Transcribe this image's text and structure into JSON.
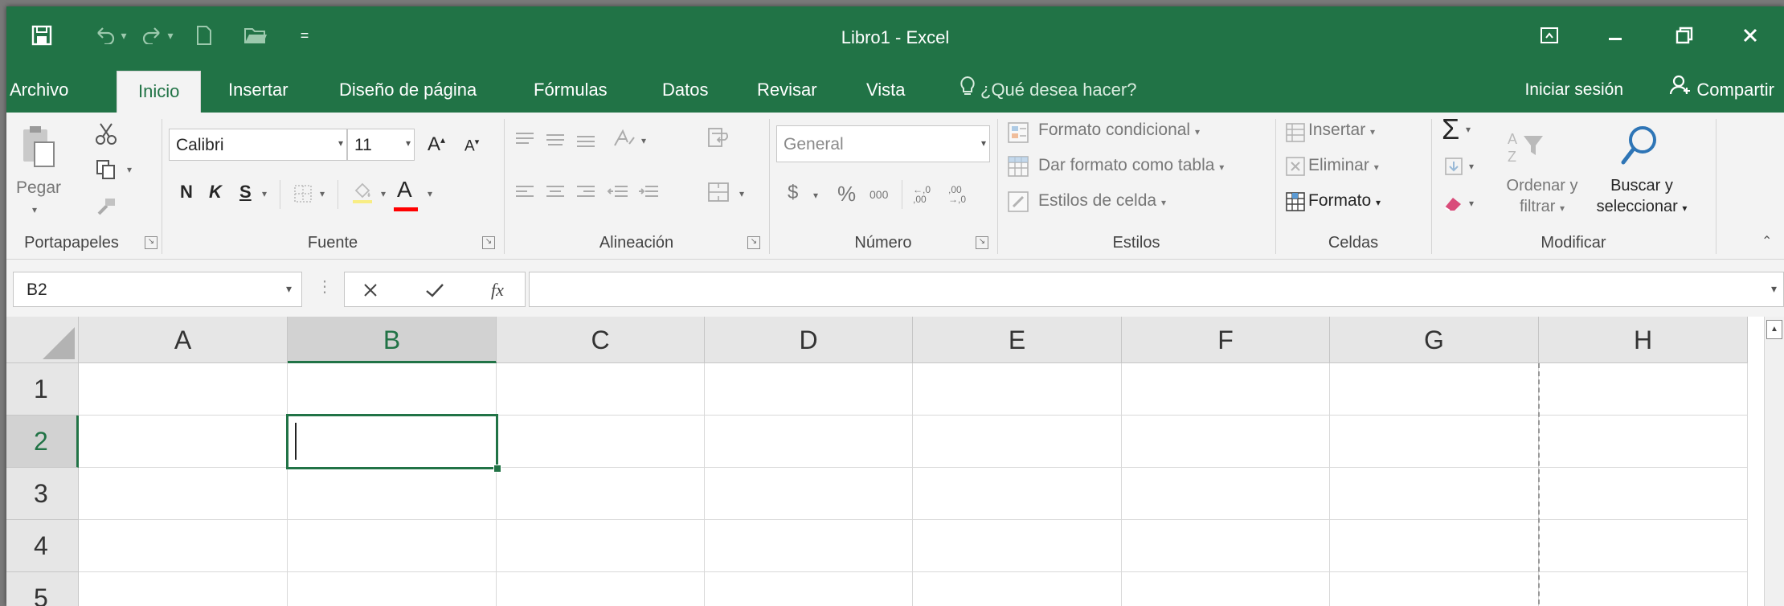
{
  "window": {
    "title": "Libro1 - Excel"
  },
  "tabs": [
    {
      "label": "Archivo"
    },
    {
      "label": "Inicio",
      "active": true
    },
    {
      "label": "Insertar"
    },
    {
      "label": "Diseño de página"
    },
    {
      "label": "Fórmulas"
    },
    {
      "label": "Datos"
    },
    {
      "label": "Revisar"
    },
    {
      "label": "Vista"
    }
  ],
  "tell_me": {
    "label": "¿Qué desea hacer?"
  },
  "account": {
    "sign_in": "Iniciar sesión",
    "share": "Compartir"
  },
  "ribbon": {
    "clipboard": {
      "label": "Portapapeles",
      "paste": "Pegar"
    },
    "font": {
      "label": "Fuente",
      "name": "Calibri",
      "size": "11",
      "bold": "N",
      "italic": "K",
      "underline": "S",
      "grow": "A",
      "shrink": "A",
      "color_letter": "A"
    },
    "alignment": {
      "label": "Alineación"
    },
    "number": {
      "label": "Número",
      "format": "General",
      "currency": "$",
      "percent": "%",
      "thousands": "000",
      "inc_decimal": "←,0 ,00",
      "dec_decimal": ",00 →,0"
    },
    "styles": {
      "label": "Estilos",
      "conditional": "Formato condicional",
      "as_table": "Dar formato como tabla",
      "cell_styles": "Estilos de celda"
    },
    "cells": {
      "label": "Celdas",
      "insert": "Insertar",
      "delete": "Eliminar",
      "format": "Formato"
    },
    "editing": {
      "label": "Modificar",
      "sort_line1": "Ordenar y",
      "sort_line2": "filtrar",
      "find_line1": "Buscar y",
      "find_line2": "seleccionar"
    }
  },
  "formula_bar": {
    "name_box": "B2",
    "value": ""
  },
  "sheet": {
    "columns": [
      "A",
      "B",
      "C",
      "D",
      "E",
      "F",
      "G",
      "H"
    ],
    "rows": [
      "1",
      "2",
      "3",
      "4",
      "5"
    ],
    "selected_cell": "B2"
  },
  "colors": {
    "accent": "#217346",
    "ribbon_bg": "#f3f3f3",
    "header_bg": "#e6e6e6",
    "font_color_bar": "#ff0000"
  }
}
